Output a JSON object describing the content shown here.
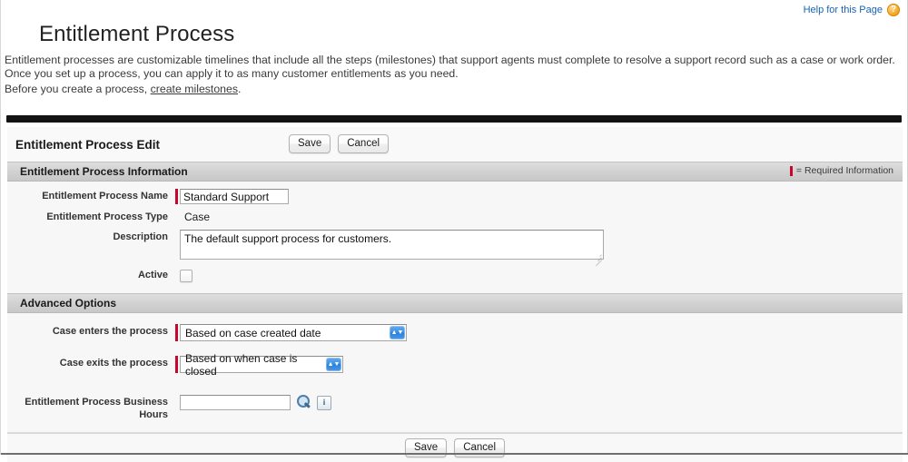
{
  "help": {
    "label": "Help for this Page",
    "icon": "help-question-icon",
    "glyph": "?",
    "color": "#1763b5"
  },
  "page": {
    "title": "Entitlement Process",
    "intro_paragraph": "Entitlement processes are customizable timelines that include all the steps (milestones) that support agents must complete to resolve a support record such as a case or work order. Once you set up a process, you can apply it to as many customer entitlements as you need.",
    "intro_prefix": "Before you create a process, ",
    "intro_link": "create milestones",
    "intro_suffix": "."
  },
  "edit_panel": {
    "title": "Entitlement Process Edit",
    "save_label": "Save",
    "cancel_label": "Cancel"
  },
  "sections": {
    "information": {
      "title": "Entitlement Process Information",
      "required_legend": "= Required Information",
      "required_marker_color": "#c6062b"
    },
    "advanced": {
      "title": "Advanced Options"
    }
  },
  "fields": {
    "process_name": {
      "label": "Entitlement Process Name",
      "value": "Standard Support",
      "placeholder": "",
      "required": true
    },
    "process_type": {
      "label": "Entitlement Process Type",
      "value": "Case",
      "required": false
    },
    "description": {
      "label": "Description",
      "value": "The default support process for customers.",
      "placeholder": "",
      "required": false
    },
    "active": {
      "label": "Active",
      "checked": false
    },
    "case_enters": {
      "label": "Case enters the process",
      "value": "Based on case created date",
      "required": true
    },
    "case_exits": {
      "label": "Case exits the process",
      "value": "Based on when case is closed",
      "required": true
    },
    "business_hours": {
      "label": "Entitlement Process Business Hours",
      "value": "",
      "placeholder": "",
      "lookup_icon": "magnifier-lookup-icon",
      "info_icon": "info-icon",
      "info_glyph": "i"
    }
  },
  "footer": {
    "save_label": "Save",
    "cancel_label": "Cancel"
  }
}
